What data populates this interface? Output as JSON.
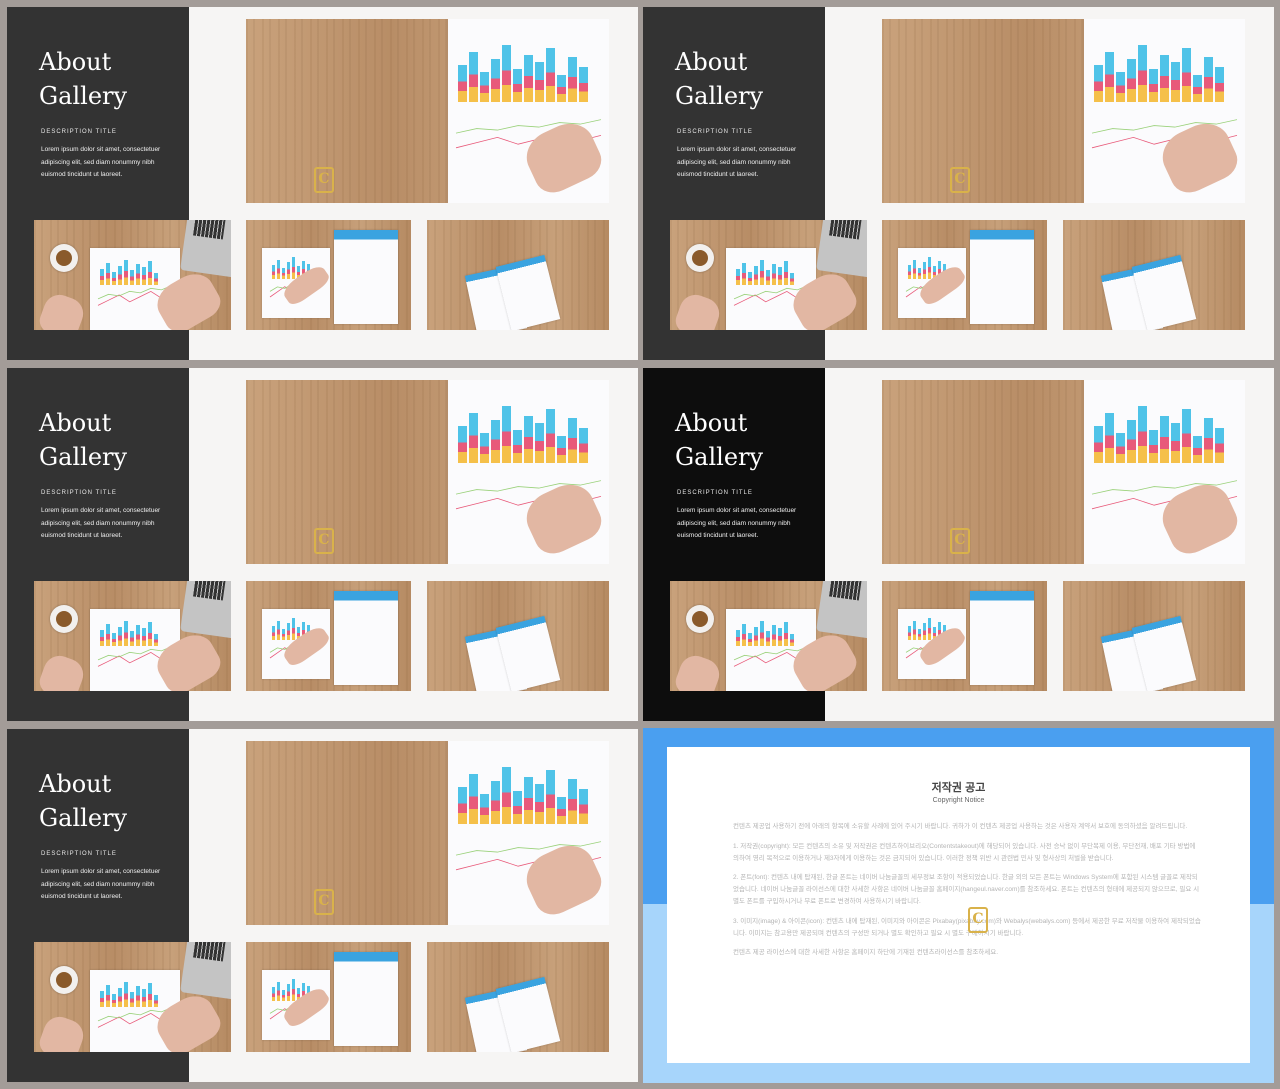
{
  "slides": [
    {
      "title_line1": "About",
      "title_line2": "Gallery",
      "desc_title": "DESCRIPTION TITLE",
      "desc_text": "Lorem ipsum dolor sit amet, consectetuer adipiscing elit, sed diam nonummy nibh euismod tincidunt ut laoreet."
    },
    {
      "title_line1": "About",
      "title_line2": "Gallery",
      "desc_title": "DESCRIPTION TITLE",
      "desc_text": "Lorem ipsum dolor sit amet, consectetuer adipiscing elit, sed diam nonummy nibh euismod tincidunt ut laoreet."
    },
    {
      "title_line1": "About",
      "title_line2": "Gallery",
      "desc_title": "DESCRIPTION TITLE",
      "desc_text": "Lorem ipsum dolor sit amet, consectetuer adipiscing elit, sed diam nonummy nibh euismod tincidunt ut laoreet."
    },
    {
      "title_line1": "About",
      "title_line2": "Gallery",
      "desc_title": "DESCRIPTION TITLE",
      "desc_text": "Lorem ipsum dolor sit amet, consectetuer adipiscing elit, sed diam nonummy nibh euismod tincidunt ut laoreet."
    },
    {
      "title_line1": "About",
      "title_line2": "Gallery",
      "desc_title": "DESCRIPTION TITLE",
      "desc_text": "Lorem ipsum dolor sit amet, consectetuer adipiscing elit, sed diam nonummy nibh euismod tincidunt ut laoreet."
    }
  ],
  "logo_letter": "C",
  "notice": {
    "title": "저작권 공고",
    "subtitle": "Copyright Notice",
    "paragraphs": [
      "컨텐츠 제공업 사용하기 전에 아래의 항목에 소유할 사례에 있어 주시기 바랍니다. 귀하가 이 컨텐츠 제공업 사용하는 것은 사용자 계약서 보호에 동의하셨음 알려드립니다.",
      "1. 저작권(copyright): 모든 컨텐츠의 소유 및 저작권은 컨텐츠하이브리오(Contentstakeout)에 해당되어 있습니다. 사전 승낙 없이 무단복제 이용, 무단전재, 배포 기타 방법에 의하여 영리 목적으로 이용하거나 제3자에게 이용하는 것은 금지되어 있습니다. 이러한 정책 위반 시 관련법 민사 및 형사상의 처벌을 받습니다.",
      "2. 폰트(font): 컨텐츠 내에 탑재된, 한글 폰트는 네이버 나눔글꼴의 세부정보 조항이 적용되었습니다. 한글 외의 모든 폰트는 Windows System에 포함된 시스템 글꼴로 제작되었습니다. 네이버 나눔글꼴 라이선스에 대한 사세한 사항은 네이버 나눔글꼴 홈페이지(hangeul.naver.com)를 참조하세요. 폰트는 컨텐츠의 형태에 제공되지 않으므로, 필요 시 별도 폰트를 구입하시거나 무료 폰트로 변경하여 사용하시기 바랍니다.",
      "3. 이미지(image) & 아이콘(icon): 컨텐츠 내에 탑재된, 이미지와 아이콘은 Pixabay(pixabay.com)와 Webalys(webalys.com) 등에서 제공한 무료 저작물 이용하여 제작되었습니다. 이미지는 참고용만 제공되며 컨텐츠의 구성만 되거나 별도 확인하고 필요 시 별도 구매하시기 바랍니다.",
      "컨텐츠 제공 라이선스에 대한 사세한 사항은 홈페이지 하단에 기재된 컨텐츠라이선스를 참조하세요."
    ]
  },
  "colors": {
    "panel": "#333333",
    "panel_black": "#0d0d0d",
    "accent_gold": "#d9b24a",
    "notice_blue": "#4a9ff0",
    "notice_light_blue": "#a7d5fb"
  }
}
